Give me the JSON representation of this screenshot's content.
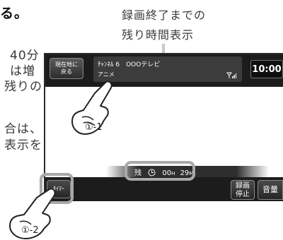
{
  "manual_text": {
    "line1_tail": "る。",
    "line2": "40分",
    "line3": "は増",
    "line4": "残りの",
    "line5": "合は、",
    "line6": "表示を"
  },
  "annotation": {
    "line1": "録画終了までの",
    "line2": "残り時間表示"
  },
  "screen": {
    "here_button": {
      "line1": "現在地に",
      "line2": "戻る"
    },
    "channel": "ﾁｬﾝﾈﾙ 6　OOOテレビ",
    "genre": "アニメ",
    "signal_icon": "signal-antenna-icon",
    "clock": "10:00",
    "remaining": {
      "prefix": "残",
      "clock_icon": "clock-icon",
      "hours": "00",
      "hours_unit": "H",
      "minutes": "29",
      "minutes_unit": "M"
    },
    "timer_button": "ﾀｲﾏｰ",
    "record_stop_button": {
      "line1": "録画",
      "line2": "停止"
    },
    "volume_button": "音量"
  },
  "steps": {
    "step1": "①-1",
    "step2": "①-2"
  },
  "colors": {
    "screen_bar": "#1c1c1c",
    "highlight": "#a9a9a9"
  }
}
